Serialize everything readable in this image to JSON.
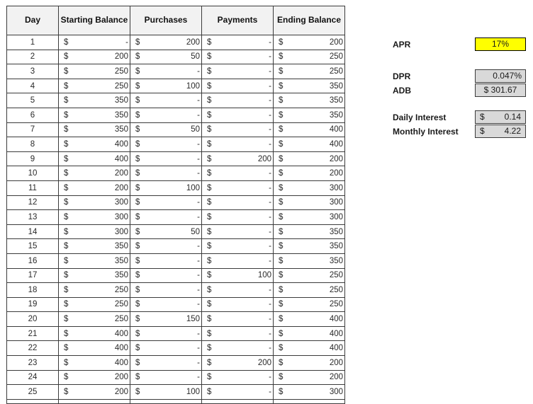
{
  "ledger": {
    "columns": [
      {
        "key": "day",
        "label": "Day"
      },
      {
        "key": "start",
        "label": "Starting Balance"
      },
      {
        "key": "purch",
        "label": "Purchases"
      },
      {
        "key": "pay",
        "label": "Payments"
      },
      {
        "key": "end",
        "label": "Ending Balance"
      }
    ],
    "currency_symbol": "$",
    "zero_glyph": "-",
    "rows": [
      {
        "day": "1",
        "start": "-",
        "purch": "200",
        "pay": "-",
        "end": "200"
      },
      {
        "day": "2",
        "start": "200",
        "purch": "50",
        "pay": "-",
        "end": "250"
      },
      {
        "day": "3",
        "start": "250",
        "purch": "-",
        "pay": "-",
        "end": "250"
      },
      {
        "day": "4",
        "start": "250",
        "purch": "100",
        "pay": "-",
        "end": "350"
      },
      {
        "day": "5",
        "start": "350",
        "purch": "-",
        "pay": "-",
        "end": "350"
      },
      {
        "day": "6",
        "start": "350",
        "purch": "-",
        "pay": "-",
        "end": "350"
      },
      {
        "day": "7",
        "start": "350",
        "purch": "50",
        "pay": "-",
        "end": "400"
      },
      {
        "day": "8",
        "start": "400",
        "purch": "-",
        "pay": "-",
        "end": "400"
      },
      {
        "day": "9",
        "start": "400",
        "purch": "-",
        "pay": "200",
        "end": "200"
      },
      {
        "day": "10",
        "start": "200",
        "purch": "-",
        "pay": "-",
        "end": "200"
      },
      {
        "day": "11",
        "start": "200",
        "purch": "100",
        "pay": "-",
        "end": "300"
      },
      {
        "day": "12",
        "start": "300",
        "purch": "-",
        "pay": "-",
        "end": "300"
      },
      {
        "day": "13",
        "start": "300",
        "purch": "-",
        "pay": "-",
        "end": "300"
      },
      {
        "day": "14",
        "start": "300",
        "purch": "50",
        "pay": "-",
        "end": "350"
      },
      {
        "day": "15",
        "start": "350",
        "purch": "-",
        "pay": "-",
        "end": "350"
      },
      {
        "day": "16",
        "start": "350",
        "purch": "-",
        "pay": "-",
        "end": "350"
      },
      {
        "day": "17",
        "start": "350",
        "purch": "-",
        "pay": "100",
        "end": "250"
      },
      {
        "day": "18",
        "start": "250",
        "purch": "-",
        "pay": "-",
        "end": "250"
      },
      {
        "day": "19",
        "start": "250",
        "purch": "-",
        "pay": "-",
        "end": "250"
      },
      {
        "day": "20",
        "start": "250",
        "purch": "150",
        "pay": "-",
        "end": "400"
      },
      {
        "day": "21",
        "start": "400",
        "purch": "-",
        "pay": "-",
        "end": "400"
      },
      {
        "day": "22",
        "start": "400",
        "purch": "-",
        "pay": "-",
        "end": "400"
      },
      {
        "day": "23",
        "start": "400",
        "purch": "-",
        "pay": "200",
        "end": "200"
      },
      {
        "day": "24",
        "start": "200",
        "purch": "-",
        "pay": "-",
        "end": "200"
      },
      {
        "day": "25",
        "start": "200",
        "purch": "100",
        "pay": "-",
        "end": "300"
      }
    ]
  },
  "calc": {
    "apr": {
      "label": "APR",
      "value": "17%"
    },
    "dpr": {
      "label": "DPR",
      "value": "0.047%"
    },
    "adb": {
      "label": "ADB",
      "symbol": "$",
      "value": "301.67"
    },
    "daily_interest": {
      "label": "Daily Interest",
      "symbol": "$",
      "value": "0.14"
    },
    "monthly_interest": {
      "label": "Monthly Interest",
      "symbol": "$",
      "value": "4.22"
    }
  },
  "colors": {
    "highlight": "#ffff00",
    "shaded": "#d9d9d9",
    "header_fill": "#f2f2f2",
    "grid": "#3b3b3b"
  }
}
